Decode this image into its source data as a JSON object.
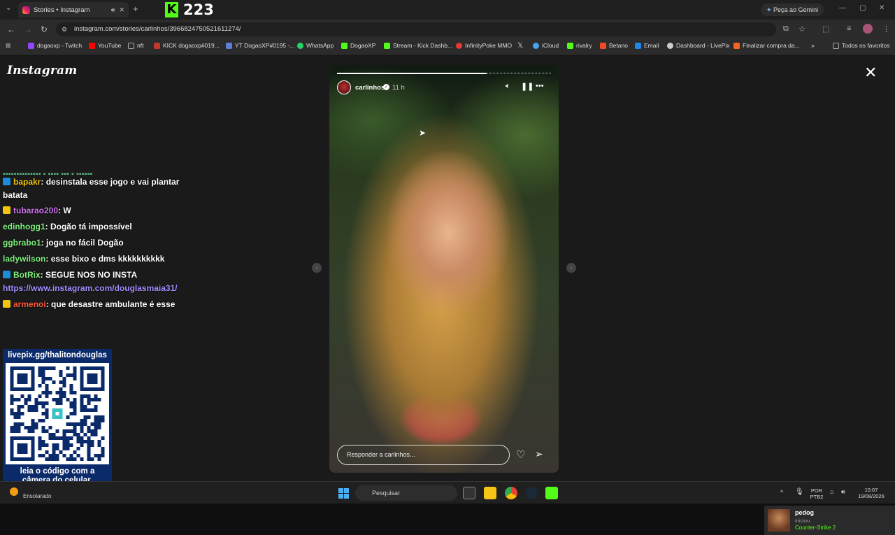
{
  "browser": {
    "tab_title": "Stories • Instagram",
    "kick_icon_label": "K",
    "kick_count": "223",
    "gemini_label": "Peça ao Gemini",
    "url": "instagram.com/stories/carlinhos/3966824750521611274/"
  },
  "bookmarks": [
    {
      "label": "dogaoxp - Twitch",
      "color": "#9146ff"
    },
    {
      "label": "YouTube",
      "color": "#ff0000"
    },
    {
      "label": "nft",
      "color": "#888888"
    },
    {
      "label": "KICK dogaoxp#019...",
      "color": "#c0392b"
    },
    {
      "label": "YT DogaoXP#0195 -...",
      "color": "#5b7fd6"
    },
    {
      "label": "WhatsApp",
      "color": "#25d366"
    },
    {
      "label": "DogaoXP",
      "color": "#53fc18"
    },
    {
      "label": "Stream - Kick Dashb...",
      "color": "#53fc18"
    },
    {
      "label": "InfinityPoke MMO",
      "color": "#e53935"
    },
    {
      "label": "",
      "color": "#ffffff"
    },
    {
      "label": "iCloud",
      "color": "#4aa3f0"
    },
    {
      "label": "rivalry",
      "color": "#53fc18"
    },
    {
      "label": "Betano",
      "color": "#f04b23"
    },
    {
      "label": "Email",
      "color": "#1e88e5"
    },
    {
      "label": "Dashboard - LivePix",
      "color": "#cccccc"
    },
    {
      "label": "Finalizar compra da...",
      "color": "#f26522"
    }
  ],
  "bookmarks_all": "Todos os favoritos",
  "instagram": {
    "logo": "Instagram",
    "story": {
      "username": "carlinhos",
      "time": "11 h",
      "reply_placeholder": "Responder a carlinhos...",
      "progress": 0.7
    }
  },
  "chat": {
    "messages": [
      {
        "user": "bapakr",
        "user_color": "#f1c40f",
        "text": ": desinstala esse jogo e vai plantar",
        "badge_color": "#1a8cd8"
      },
      {
        "user": "",
        "user_color": "#ffffff",
        "text": "batata",
        "badge_color": ""
      },
      {
        "user": "tubarao200",
        "user_color": "#d070f0",
        "text": ": W",
        "badge_color": "#f1c40f"
      },
      {
        "user": "edinhogg1",
        "user_color": "#7ef07e",
        "text": ": Dogão tá impossível",
        "badge_color": ""
      },
      {
        "user": "ggbrabo1",
        "user_color": "#7ef07e",
        "text": ": joga no fácil Dogão",
        "badge_color": ""
      },
      {
        "user": "ladywilson",
        "user_color": "#7ef07e",
        "text": ": esse bixo e dms kkkkkkkkkk",
        "badge_color": ""
      },
      {
        "user": "BotRix",
        "user_color": "#7ef07e",
        "text": ": SEGUE NOS NO INSTA",
        "badge_color": "#1a8cd8"
      },
      {
        "user": "",
        "user_color": "#a58cff",
        "text": "https://www.instagram.com/douglasmaia31/",
        "badge_color": ""
      },
      {
        "user": "armenoi",
        "user_color": "#ff5a3c",
        "text": ": que desastre ambulante é esse",
        "badge_color": "#f1c40f"
      }
    ]
  },
  "livepix": {
    "url": "livepix.gg/thalitondouglas",
    "cta_line1": "leia o código com a",
    "cta_line2": "câmera do celular."
  },
  "notification": {
    "user": "pedog",
    "action": "iniciou",
    "game": "Counter-Strike 2"
  },
  "taskbar": {
    "weather": "Ensolarado",
    "search": "Pesquisar",
    "lang1": "POR",
    "lang2": "PTB2",
    "time": "10:07",
    "date": "19/08/2026"
  }
}
